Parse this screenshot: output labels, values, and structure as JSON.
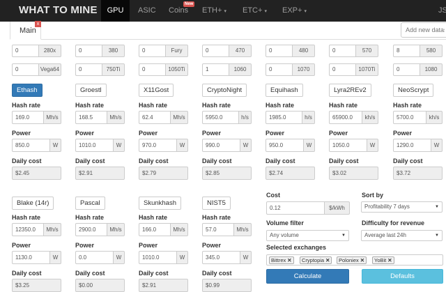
{
  "nav": {
    "brand": "WHAT TO MINE",
    "items": [
      {
        "label": "GPU",
        "active": true
      },
      {
        "label": "ASIC"
      },
      {
        "label": "Coins",
        "badge": "New"
      },
      {
        "label": "ETH+",
        "caret": "▾"
      },
      {
        "label": "ETC+",
        "caret": "▾"
      },
      {
        "label": "EXP+",
        "caret": "▾"
      }
    ],
    "user": "JS"
  },
  "tabs": {
    "main_label": "Main",
    "close_glyph": "x"
  },
  "dataset": {
    "placeholder": "Add new datas"
  },
  "gpus": {
    "row1": [
      {
        "qty": "0",
        "model": "280x"
      },
      {
        "qty": "0",
        "model": "380"
      },
      {
        "qty": "0",
        "model": "Fury"
      },
      {
        "qty": "0",
        "model": "470"
      },
      {
        "qty": "0",
        "model": "480"
      },
      {
        "qty": "0",
        "model": "570"
      },
      {
        "qty": "8",
        "model": "580"
      }
    ],
    "row2": [
      {
        "qty": "0",
        "model": "Vega64"
      },
      {
        "qty": "0",
        "model": "750Ti"
      },
      {
        "qty": "0",
        "model": "1050Ti"
      },
      {
        "qty": "1",
        "model": "1060"
      },
      {
        "qty": "0",
        "model": "1070"
      },
      {
        "qty": "0",
        "model": "1070Ti"
      },
      {
        "qty": "0",
        "model": "1080"
      }
    ]
  },
  "labels": {
    "hashrate": "Hash rate",
    "power": "Power",
    "daily_cost": "Daily cost"
  },
  "algos_row1": [
    {
      "name": "Ethash",
      "active": true,
      "hashrate": "169.0",
      "unit": "Mh/s",
      "power": "850.0",
      "power_unit": "W",
      "cost": "$2.45"
    },
    {
      "name": "Groestl",
      "hashrate": "168.5",
      "unit": "Mh/s",
      "power": "1010.0",
      "power_unit": "W",
      "cost": "$2.91"
    },
    {
      "name": "X11Gost",
      "hashrate": "62.4",
      "unit": "Mh/s",
      "power": "970.0",
      "power_unit": "W",
      "cost": "$2.79"
    },
    {
      "name": "CryptoNight",
      "hashrate": "5950.0",
      "unit": "h/s",
      "power": "990.0",
      "power_unit": "W",
      "cost": "$2.85"
    },
    {
      "name": "Equihash",
      "hashrate": "1985.0",
      "unit": "h/s",
      "power": "950.0",
      "power_unit": "W",
      "cost": "$2.74"
    },
    {
      "name": "Lyra2REv2",
      "hashrate": "65900.0",
      "unit": "kh/s",
      "power": "1050.0",
      "power_unit": "W",
      "cost": "$3.02"
    },
    {
      "name": "NeoScrypt",
      "hashrate": "5700.0",
      "unit": "kh/s",
      "power": "1290.0",
      "power_unit": "W",
      "cost": "$3.72"
    }
  ],
  "algos_row2": [
    {
      "name": "Blake (14r)",
      "hashrate": "12350.0",
      "unit": "Mh/s",
      "power": "1130.0",
      "power_unit": "W",
      "cost": "$3.25"
    },
    {
      "name": "Pascal",
      "hashrate": "2900.0",
      "unit": "Mh/s",
      "power": "0.0",
      "power_unit": "W",
      "cost": "$0.00"
    },
    {
      "name": "Skunkhash",
      "hashrate": "166.0",
      "unit": "Mh/s",
      "power": "1010.0",
      "power_unit": "W",
      "cost": "$2.91"
    },
    {
      "name": "NIST5",
      "hashrate": "57.0",
      "unit": "Mh/s",
      "power": "345.0",
      "power_unit": "W",
      "cost": "$0.99"
    }
  ],
  "settings": {
    "cost_label": "Cost",
    "cost_value": "0.12",
    "cost_unit": "$/kWh",
    "sort_label": "Sort by",
    "sort_value": "Profitability 7 days",
    "volume_label": "Volume filter",
    "volume_value": "Any volume",
    "difficulty_label": "Difficulty for revenue",
    "difficulty_value": "Average last 24h",
    "exchanges_label": "Selected exchanges",
    "exchanges": [
      "Bittrex",
      "Cryptopia",
      "Poloniex",
      "YoBit"
    ],
    "remove_glyph": "✕",
    "dropdown_glyph": "▼",
    "calculate_label": "Calculate",
    "defaults_label": "Defaults"
  },
  "colors": {
    "primary": "#337ab7",
    "info": "#5bc0de",
    "danger": "#d9534f",
    "navbar": "#222222"
  }
}
